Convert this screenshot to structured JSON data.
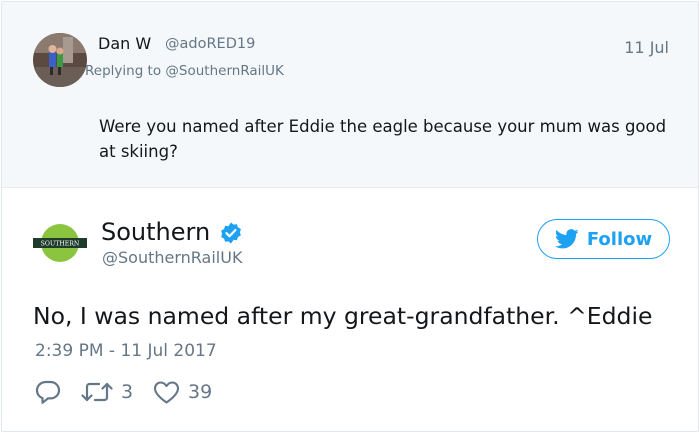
{
  "parent_tweet": {
    "author_name": "Dan W",
    "author_handle": "@adoRED19",
    "date": "11 Jul",
    "replying_prefix": "Replying to",
    "replying_to": "@SouthernRailUK",
    "text": "Were you named after Eddie the eagle because your mum was good at skiing?"
  },
  "main_tweet": {
    "author_name": "Southern",
    "author_handle": "@SouthernRailUK",
    "avatar_text": "SOUTHERN",
    "follow_label": "Follow",
    "text": "No, I was named after my great-grandfather. ^Eddie",
    "timestamp": "2:39 PM - 11 Jul 2017",
    "retweet_count": "3",
    "like_count": "39"
  },
  "icons": {
    "reply": "reply-icon",
    "retweet": "retweet-icon",
    "like": "heart-icon",
    "verified": "verified-badge-icon",
    "follow": "twitter-bird-icon"
  },
  "colors": {
    "accent": "#1da1f2",
    "muted": "#657786",
    "text": "#14171a",
    "parent_background": "#f5f8fa",
    "southern_green": "#8bc53f",
    "southern_dark": "#1f3b2b"
  }
}
